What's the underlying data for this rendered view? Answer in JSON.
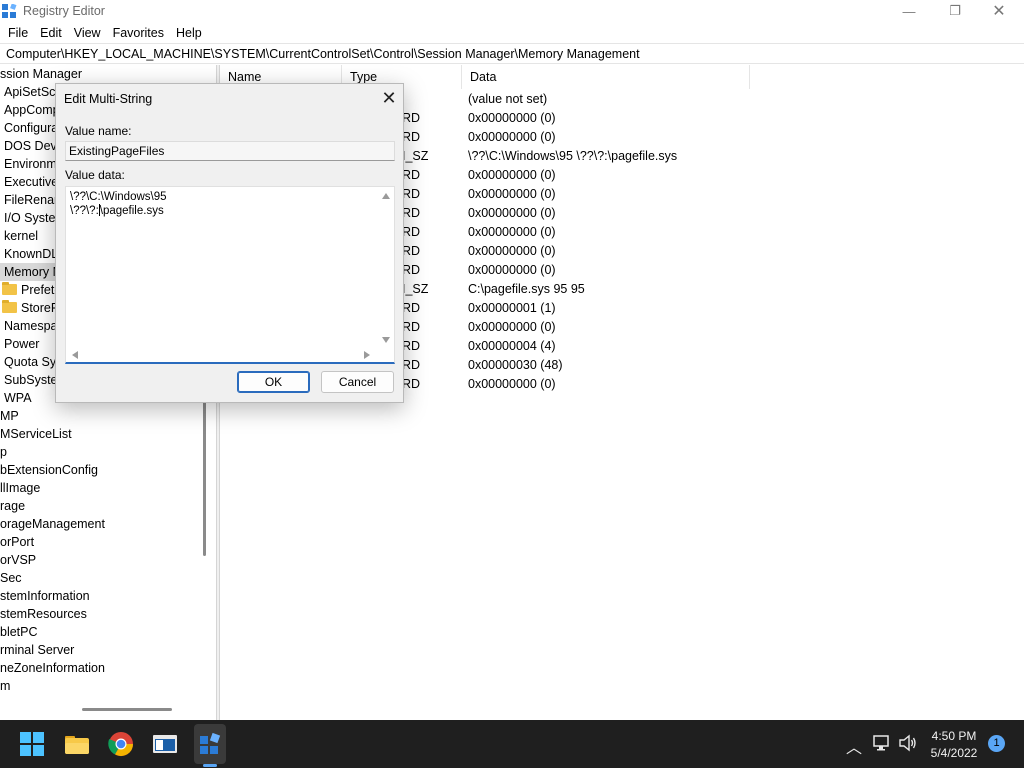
{
  "window": {
    "title": "Registry Editor",
    "minimize": "—",
    "maximize": "❐",
    "close": "✕"
  },
  "menu": [
    "File",
    "Edit",
    "View",
    "Favorites",
    "Help"
  ],
  "address": "Computer\\HKEY_LOCAL_MACHINE\\SYSTEM\\CurrentControlSet\\Control\\Session Manager\\Memory Management",
  "tree": {
    "items": [
      {
        "label": "ssion Manager",
        "folder": false,
        "selected": false
      },
      {
        "label": "ApiSetSch",
        "folder": false,
        "selected": false
      },
      {
        "label": "AppComp",
        "folder": false,
        "selected": false
      },
      {
        "label": "Configura",
        "folder": false,
        "selected": false
      },
      {
        "label": "DOS Devic",
        "folder": false,
        "selected": false
      },
      {
        "label": "Environm",
        "folder": false,
        "selected": false
      },
      {
        "label": "Executive",
        "folder": false,
        "selected": false
      },
      {
        "label": "FileRenam",
        "folder": false,
        "selected": false
      },
      {
        "label": "I/O Syster",
        "folder": false,
        "selected": false
      },
      {
        "label": "kernel",
        "folder": false,
        "selected": false
      },
      {
        "label": "KnownDL",
        "folder": false,
        "selected": false
      },
      {
        "label": "Memory M",
        "folder": false,
        "selected": true
      },
      {
        "label": "Prefetc",
        "folder": true,
        "selected": false
      },
      {
        "label": "StoreP",
        "folder": true,
        "selected": false
      },
      {
        "label": "Namespa",
        "folder": false,
        "selected": false
      },
      {
        "label": "Power",
        "folder": false,
        "selected": false
      },
      {
        "label": "Quota Sys",
        "folder": false,
        "selected": false
      },
      {
        "label": "SubSyster",
        "folder": false,
        "selected": false
      },
      {
        "label": "WPA",
        "folder": false,
        "selected": false
      },
      {
        "label": "MP",
        "folder": false,
        "selected": false
      },
      {
        "label": "MServiceList",
        "folder": false,
        "selected": false
      },
      {
        "label": "p",
        "folder": false,
        "selected": false
      },
      {
        "label": "bExtensionConfig",
        "folder": false,
        "selected": false
      },
      {
        "label": "llImage",
        "folder": false,
        "selected": false
      },
      {
        "label": "rage",
        "folder": false,
        "selected": false
      },
      {
        "label": "orageManagement",
        "folder": false,
        "selected": false
      },
      {
        "label": "orPort",
        "folder": false,
        "selected": false
      },
      {
        "label": "orVSP",
        "folder": false,
        "selected": false
      },
      {
        "label": "Sec",
        "folder": false,
        "selected": false
      },
      {
        "label": "stemInformation",
        "folder": false,
        "selected": false
      },
      {
        "label": "stemResources",
        "folder": false,
        "selected": false
      },
      {
        "label": "bletPC",
        "folder": false,
        "selected": false
      },
      {
        "label": "rminal Server",
        "folder": false,
        "selected": false
      },
      {
        "label": "neZoneInformation",
        "folder": false,
        "selected": false
      },
      {
        "label": "m",
        "folder": false,
        "selected": false
      }
    ]
  },
  "list": {
    "columns": [
      "Name",
      "Type",
      "Data"
    ],
    "rows": [
      {
        "type": "",
        "data": "(value not set)"
      },
      {
        "type": "RD",
        "data": "0x00000000 (0)"
      },
      {
        "type": "RD",
        "data": "0x00000000 (0)"
      },
      {
        "type": "I_SZ",
        "data": "\\??\\C:\\Windows\\95 \\??\\?:\\pagefile.sys"
      },
      {
        "type": "RD",
        "data": "0x00000000 (0)"
      },
      {
        "type": "RD",
        "data": "0x00000000 (0)"
      },
      {
        "type": "RD",
        "data": "0x00000000 (0)"
      },
      {
        "type": "RD",
        "data": "0x00000000 (0)"
      },
      {
        "type": "RD",
        "data": "0x00000000 (0)"
      },
      {
        "type": "RD",
        "data": "0x00000000 (0)"
      },
      {
        "type": "I_SZ",
        "data": "C:\\pagefile.sys 95 95"
      },
      {
        "type": "RD",
        "data": "0x00000001 (1)"
      },
      {
        "type": "RD",
        "data": "0x00000000 (0)"
      },
      {
        "type": "RD",
        "data": "0x00000004 (4)"
      },
      {
        "type": "RD",
        "data": "0x00000030 (48)"
      },
      {
        "type": "RD",
        "data": "0x00000000 (0)"
      }
    ]
  },
  "dialog": {
    "title": "Edit Multi-String",
    "close": "✕",
    "value_name_label": "Value name:",
    "value_name": "ExistingPageFiles",
    "value_data_label": "Value data:",
    "value_data_line1": "\\??\\C:\\Windows\\95",
    "value_data_line2_before": "\\??\\?:",
    "value_data_line2_after": "\\pagefile.sys",
    "ok": "OK",
    "cancel": "Cancel"
  },
  "taskbar": {
    "time": "4:50 PM",
    "date": "5/4/2022",
    "notifications": "1",
    "accent": "#5aa6f5"
  }
}
